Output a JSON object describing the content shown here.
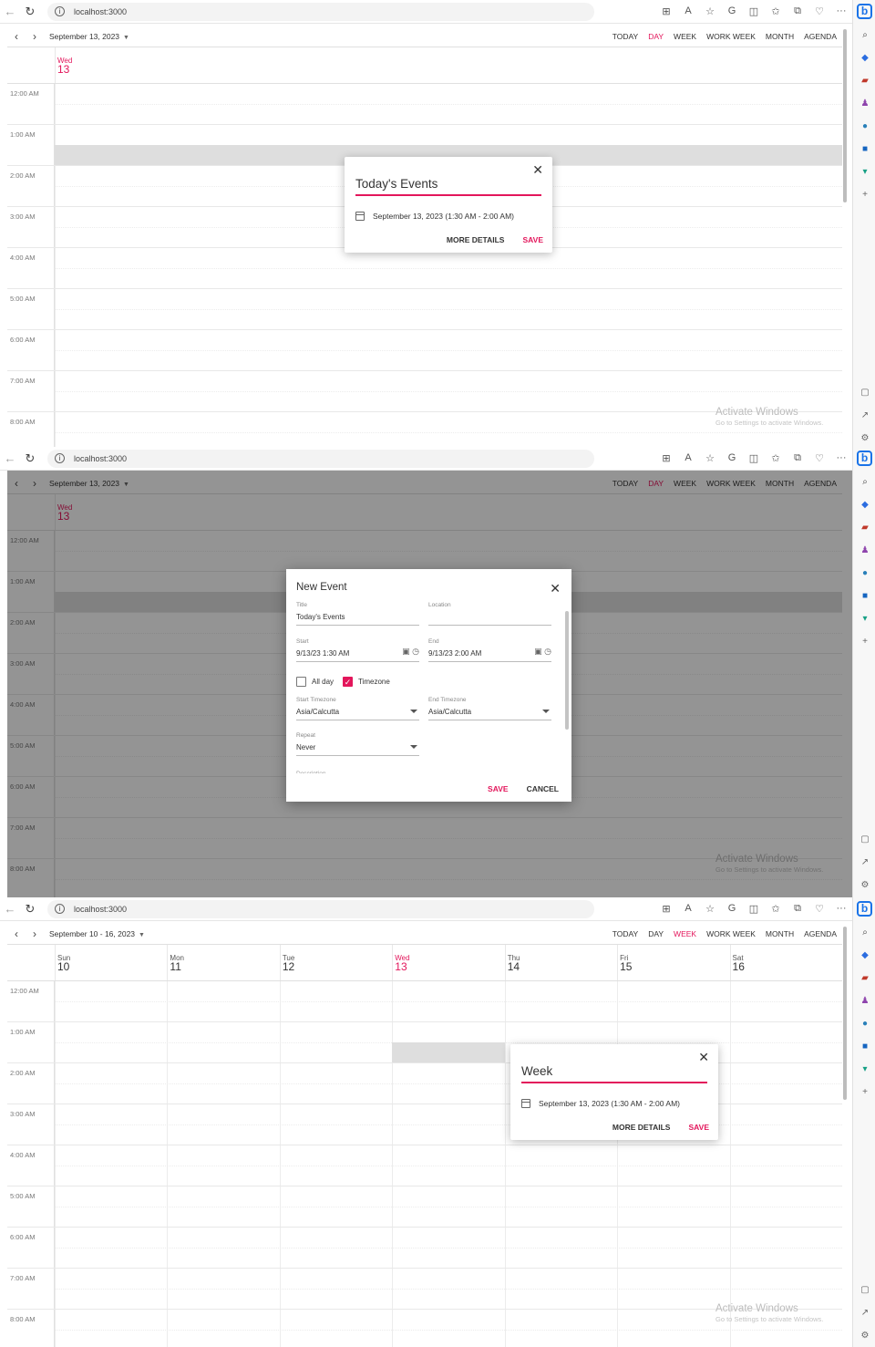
{
  "browser": {
    "url": "localhost:3000"
  },
  "views": [
    "TODAY",
    "DAY",
    "WEEK",
    "WORK WEEK",
    "MONTH",
    "AGENDA"
  ],
  "time_slots": [
    "12:00 AM",
    "1:00 AM",
    "2:00 AM",
    "3:00 AM",
    "4:00 AM",
    "5:00 AM",
    "6:00 AM",
    "7:00 AM",
    "8:00 AM"
  ],
  "watermark": {
    "title": "Activate Windows",
    "subtitle": "Go to Settings to activate Windows."
  },
  "panel1": {
    "date_range": "September 13, 2023",
    "active_view": "DAY",
    "day_name": "Wed",
    "day_num": "13",
    "popup": {
      "subject": "Today's Events",
      "when": "September 13, 2023 (1:30 AM - 2:00 AM)",
      "more_details": "MORE DETAILS",
      "save": "SAVE"
    }
  },
  "panel2": {
    "date_range": "September 13, 2023",
    "active_view": "DAY",
    "day_name": "Wed",
    "day_num": "13",
    "dialog": {
      "title": "New Event",
      "title_label": "Title",
      "title_value": "Today's Events",
      "location_label": "Location",
      "location_value": "",
      "start_label": "Start",
      "start_value": "9/13/23 1:30 AM",
      "end_label": "End",
      "end_value": "9/13/23 2:00 AM",
      "allday_label": "All day",
      "timezone_label": "Timezone",
      "start_tz_label": "Start Timezone",
      "start_tz_value": "Asia/Calcutta",
      "end_tz_label": "End Timezone",
      "end_tz_value": "Asia/Calcutta",
      "repeat_label": "Repeat",
      "repeat_value": "Never",
      "description_label": "Description",
      "save": "SAVE",
      "cancel": "CANCEL"
    }
  },
  "panel3": {
    "date_range": "September 10 - 16, 2023",
    "active_view": "WEEK",
    "days": [
      {
        "name": "Sun",
        "num": "10"
      },
      {
        "name": "Mon",
        "num": "11"
      },
      {
        "name": "Tue",
        "num": "12"
      },
      {
        "name": "Wed",
        "num": "13"
      },
      {
        "name": "Thu",
        "num": "14"
      },
      {
        "name": "Fri",
        "num": "15"
      },
      {
        "name": "Sat",
        "num": "16"
      }
    ],
    "today_index": 3,
    "popup": {
      "subject": "Week",
      "when": "September 13, 2023 (1:30 AM - 2:00 AM)",
      "more_details": "MORE DETAILS",
      "save": "SAVE"
    }
  }
}
